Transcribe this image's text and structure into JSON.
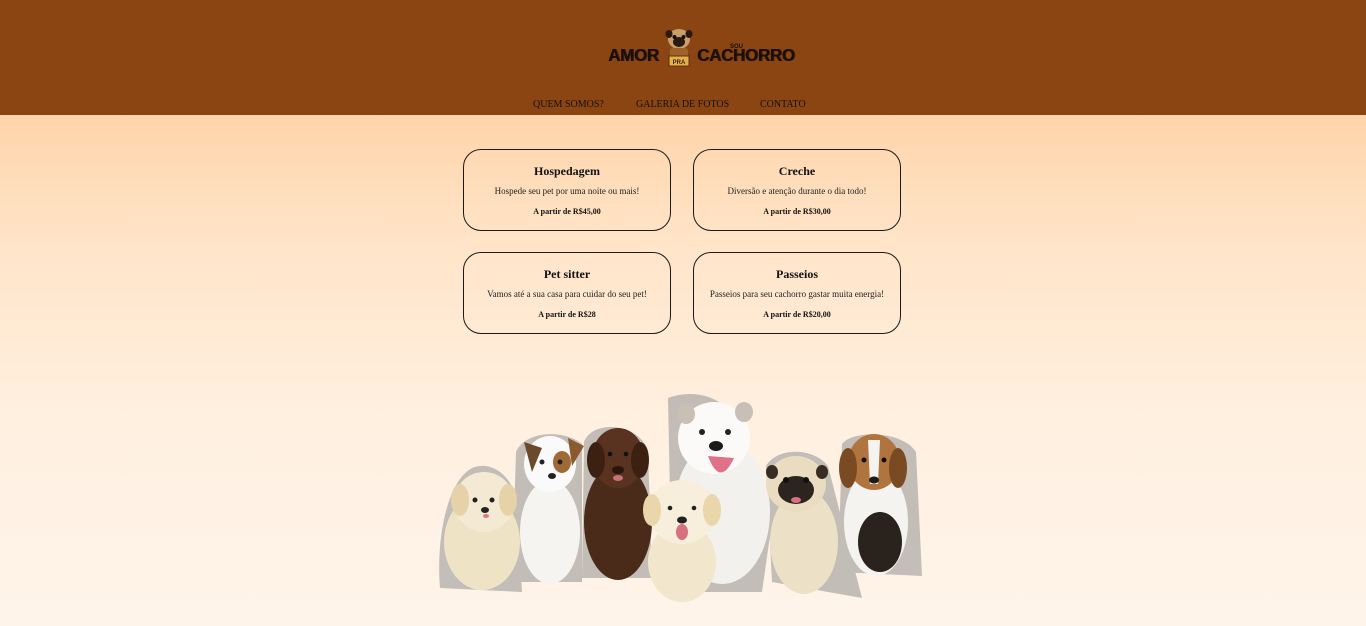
{
  "header": {
    "logo": {
      "word1": "AMOR",
      "badge": "PRA",
      "word2": "CACHORRO",
      "small": "SOU"
    },
    "bg_color": "#8b4513"
  },
  "nav": {
    "items": [
      {
        "label": "QUEM SOMOS?"
      },
      {
        "label": "GALERIA DE FOTOS"
      },
      {
        "label": "CONTATO"
      }
    ]
  },
  "services": [
    {
      "title": "Hospedagem",
      "description": "Hospede seu pet por uma noite ou mais!",
      "price": "A partir de R$45,00"
    },
    {
      "title": "Creche",
      "description": "Diversão e atenção durante o dia todo!",
      "price": "A partir de R$30,00"
    },
    {
      "title": "Pet sitter",
      "description": "Vamos até a sua casa para cuidar do seu pet!",
      "price": "A partir de R$28"
    },
    {
      "title": "Passeios",
      "description": "Passeios para seu cachorro gastar muita energia!",
      "price": "A partir de R$20,00"
    }
  ],
  "hero_image": {
    "icon": "group-of-dogs-image"
  }
}
